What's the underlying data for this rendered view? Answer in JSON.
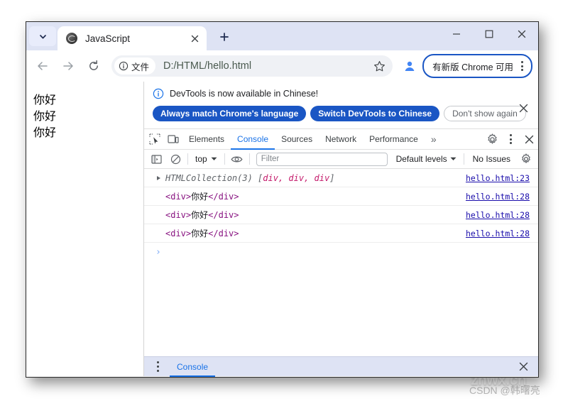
{
  "browser": {
    "tab": {
      "title": "JavaScript",
      "favicon_name": "globe-favicon",
      "close_label": "✕"
    },
    "tab_search_name": "tab-search-chevron",
    "new_tab_label": "+",
    "window_controls": {
      "minimize": "—",
      "maximize": "□",
      "close": "✕"
    },
    "toolbar": {
      "back": "←",
      "forward": "→",
      "reload": "↻",
      "file_chip_label": "文件",
      "url": "D:/HTML/hello.html",
      "star_name": "bookmark-star-icon",
      "profile_name": "profile-avatar-icon",
      "update_label": "有新版 Chrome 可用"
    }
  },
  "page": {
    "lines": [
      "你好",
      "你好",
      "你好"
    ]
  },
  "devtools": {
    "banner": {
      "message": "DevTools is now available in Chinese!",
      "primary_button": "Always match Chrome's language",
      "secondary_button": "Switch DevTools to Chinese",
      "tertiary_button": "Don't show again",
      "close": "✕"
    },
    "tabs": [
      {
        "label": "Elements",
        "active": false
      },
      {
        "label": "Console",
        "active": true
      },
      {
        "label": "Sources",
        "active": false
      },
      {
        "label": "Network",
        "active": false
      },
      {
        "label": "Performance",
        "active": false
      }
    ],
    "overflow_label": "»",
    "console_toolbar": {
      "context": "top",
      "filter_placeholder": "Filter",
      "filter_value": "",
      "levels": "Default levels",
      "issues": "No Issues"
    },
    "console_rows": [
      {
        "expandable": true,
        "prefix": "HTMLCollection(3) ",
        "bracket_open": "[",
        "items": "div, div, div",
        "bracket_close": "]",
        "tag_open": "",
        "tag_text": "",
        "tag_close": "",
        "link": "hello.html:23"
      },
      {
        "expandable": false,
        "prefix": "",
        "bracket_open": "",
        "items": "",
        "bracket_close": "",
        "tag_open": "<div>",
        "tag_text": "你好",
        "tag_close": "</div>",
        "link": "hello.html:28"
      },
      {
        "expandable": false,
        "prefix": "",
        "bracket_open": "",
        "items": "",
        "bracket_close": "",
        "tag_open": "<div>",
        "tag_text": "你好",
        "tag_close": "</div>",
        "link": "hello.html:28"
      },
      {
        "expandable": false,
        "prefix": "",
        "bracket_open": "",
        "items": "",
        "bracket_close": "",
        "tag_open": "<div>",
        "tag_text": "你好",
        "tag_close": "</div>",
        "link": "hello.html:28"
      }
    ],
    "prompt_symbol": "›",
    "drawer": {
      "tab_label": "Console",
      "close": "✕"
    }
  },
  "watermark": {
    "big": "znwx.cn",
    "small": "CSDN @韩曙亮"
  },
  "colors": {
    "accent_blue": "#1a73e8",
    "button_blue": "#1a56c4",
    "tabstrip": "#dee3f4",
    "link": "#1a0dab",
    "token_div": "#c41a6b",
    "token_tag": "#881280"
  }
}
